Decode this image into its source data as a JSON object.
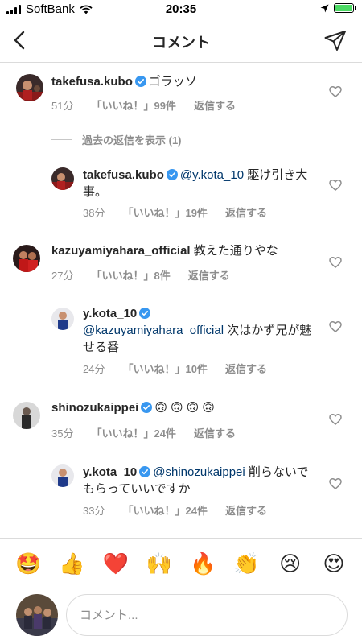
{
  "status_bar": {
    "carrier": "SoftBank",
    "time": "20:35"
  },
  "header": {
    "title": "コメント"
  },
  "view_replies": "過去の返信を表示 (1)",
  "comments": [
    {
      "username": "takefusa.kubo",
      "verified": true,
      "text": "ゴラッソ",
      "time": "51分",
      "likes": "「いいね！」99件",
      "reply": "返信する"
    },
    {
      "username": "takefusa.kubo",
      "verified": true,
      "mention": "@y.kota_10",
      "text": " 駆け引き大事。",
      "time": "38分",
      "likes": "「いいね！」19件",
      "reply": "返信する"
    },
    {
      "username": "kazuyamiyahara_official",
      "verified": false,
      "text": " 教えた通りやな",
      "time": "27分",
      "likes": "「いいね！」8件",
      "reply": "返信する"
    },
    {
      "username": "y.kota_10",
      "verified": true,
      "mention": "@kazuyamiyahara_official",
      "text": " 次はかず兄が魅せる番",
      "time": "24分",
      "likes": "「いいね！」10件",
      "reply": "返信する"
    },
    {
      "username": "shinozukaippei",
      "verified": true,
      "text": "🙃🙃🙃🙃",
      "time": "35分",
      "likes": "「いいね！」24件",
      "reply": "返信する"
    },
    {
      "username": "y.kota_10",
      "verified": true,
      "mention": "@shinozukaippei",
      "text": " 削らないでもらっていいですか",
      "time": "33分",
      "likes": "「いいね！」24件",
      "reply": "返信する"
    }
  ],
  "emoji_bar": [
    "🤩",
    "👍",
    "❤️",
    "🙌",
    "🔥",
    "👏",
    "😢",
    "😍"
  ],
  "composer": {
    "placeholder": "コメント..."
  },
  "colors": {
    "verified": "#3897f0",
    "meta": "#8e8e8e",
    "mention": "#00376b",
    "battery": "#4cd964"
  },
  "icons": [
    "signal-icon",
    "wifi-icon",
    "location-icon",
    "battery-icon",
    "back-icon",
    "send-icon",
    "verified-icon",
    "heart-icon"
  ]
}
